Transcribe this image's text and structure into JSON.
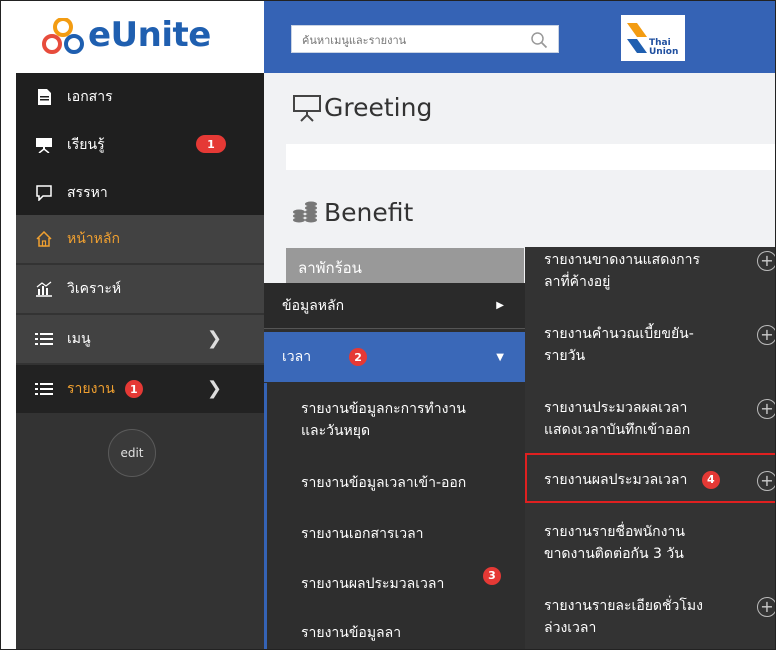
{
  "app": {
    "title": "eUnite"
  },
  "search": {
    "placeholder": "ค้นหาเมนูและรายงาน"
  },
  "partner_logo": {
    "line1": "Thai",
    "line2": "Union"
  },
  "sidebar": {
    "items": [
      {
        "label": "เอกสาร",
        "icon": "document-icon"
      },
      {
        "label": "เรียนรู้",
        "icon": "presentation-icon",
        "badge": "1"
      },
      {
        "label": "สรรหา",
        "icon": "speech-bubble-icon"
      },
      {
        "label": "หน้าหลัก",
        "icon": "home-icon"
      },
      {
        "label": "วิเคราะห์",
        "icon": "bar-chart-icon"
      },
      {
        "label": "เมนู",
        "icon": "list-icon"
      },
      {
        "label": "รายงาน",
        "icon": "list-icon",
        "badge": "1"
      }
    ],
    "edit_label": "edit"
  },
  "main": {
    "greeting_title": "Greeting",
    "benefit_title": "Benefit",
    "leave_label": "ลาพักร้อน"
  },
  "submenu1": {
    "header": "ข้อมูลหลัก",
    "selected": "เวลา",
    "selected_badge": "2",
    "entries": [
      {
        "line1": "รายงานข้อมูลกะการทำงาน",
        "line2": "และวันหยุด"
      },
      {
        "line1": "รายงานข้อมูลเวลาเข้า-ออก",
        "line2": ""
      },
      {
        "line1": "รายงานเอกสารเวลา",
        "line2": ""
      },
      {
        "line1": "รายงานผลประมวลเวลา",
        "line2": "",
        "badge": "3"
      },
      {
        "line1": "รายงานข้อมูลลา",
        "line2": ""
      }
    ]
  },
  "submenu2": {
    "entries": [
      {
        "line1": "รายงานขาดงานแสดงการ",
        "line2": "ลาที่ค้างอยู่"
      },
      {
        "line1": "รายงานคำนวณเบี้ยขยัน-",
        "line2": "รายวัน"
      },
      {
        "line1": "รายงานประมวลผลเวลา",
        "line2": "แสดงเวลาบันทึกเข้าออก"
      },
      {
        "line1": "รายงานผลประมวลเวลา",
        "line2": "",
        "badge": "4"
      },
      {
        "line1": "รายงานรายชื่อพนักงาน",
        "line2": "ขาดงานติดต่อกัน 3 วัน"
      },
      {
        "line1": "รายงานรายละเอียดชั่วโมง",
        "line2": "ล่วงเวลา"
      }
    ]
  },
  "colors": {
    "accent_blue": "#3563b5",
    "sidebar_bg": "#333333",
    "highlight_orange": "#f0a030",
    "badge_red": "#e53935",
    "outline_red": "#e02020"
  }
}
